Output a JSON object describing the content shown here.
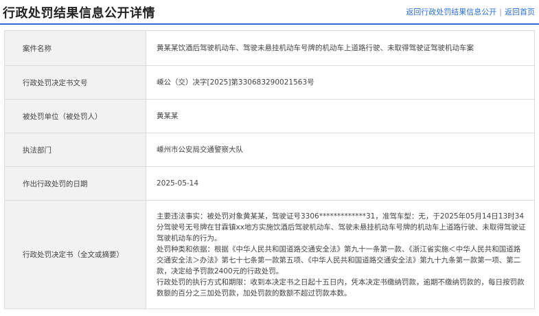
{
  "header": {
    "title": "行政处罚结果信息公开详情",
    "back_link": "返回行政处罚结果信息公开",
    "separator": "|",
    "home_link": "返回首页"
  },
  "rows": [
    {
      "label": "案件名称",
      "value": "黄某某饮酒后驾驶机动车、驾驶未悬挂机动车号牌的机动车上道路行驶、未取得驾驶证驾驶机动车案"
    },
    {
      "label": "行政处罚决定书文号",
      "value": "嵊公（交）决字[2025]第330683290021563号"
    },
    {
      "label": "被处罚单位（被处罚人）",
      "value": "黄某某"
    },
    {
      "label": "执法部门",
      "value": "嵊州市公安局交通警察大队"
    },
    {
      "label": "作出行政处罚的日期",
      "value": "2025-05-14"
    }
  ],
  "decision": {
    "label": "行政处罚决定书（全文或摘要）",
    "paragraphs": [
      "主要违法事实：被处罚对象黄某某，驾驶证号3306*************31，准驾车型：无，于2025年05月14日13时34分驾驶号无号牌在甘霖镇xx地方实施饮酒后驾驶机动车、驾驶未悬挂机动车号牌的机动车上道路行驶、未取得驾驶证驾驶机动车的行为。",
      "处罚种类和依据：根据《中华人民共和国道路交通安全法》第九十一条第一款、《浙江省实施＜中华人民共和国道路交通安全法＞办法》第七十七条第一款第五项、《中华人民共和国道路交通安全法》第九十九条第一款第一项、第二款，决定给予罚款2400元的行政处罚。",
      "行政处罚的执行方式和期限：收到本决定书之日起十五日内，凭本决定书缴纳罚款，逾期不缴纳罚款的，每日按罚款数额的百分之三加处罚款，加处罚款的数额不超过罚款本数。"
    ]
  }
}
